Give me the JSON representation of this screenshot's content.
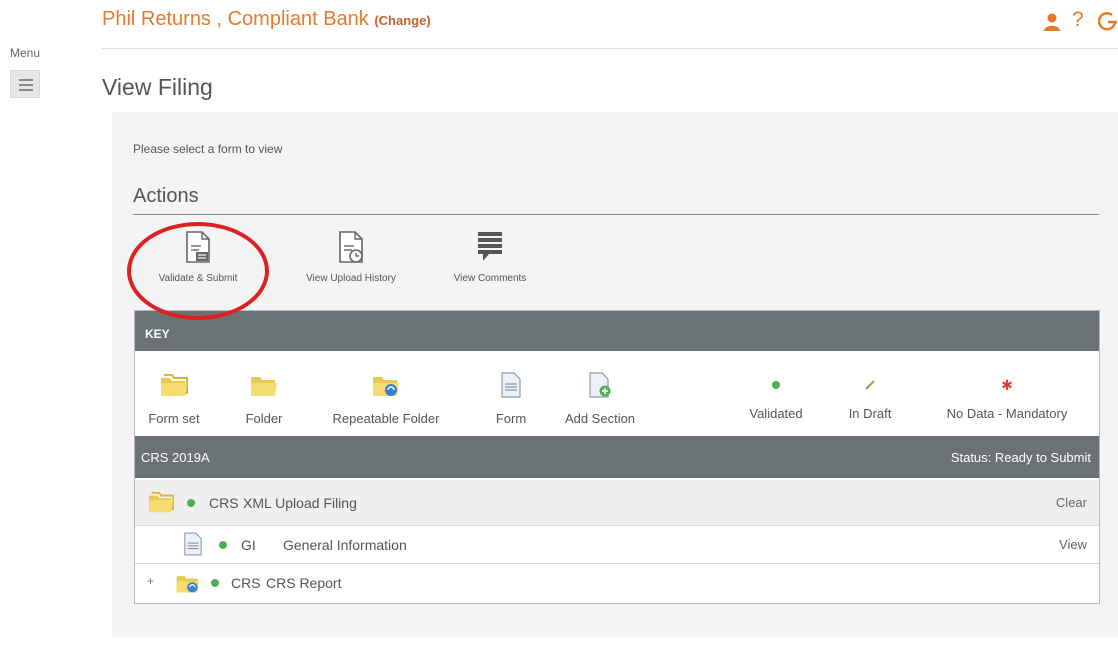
{
  "menu": {
    "label": "Menu"
  },
  "header": {
    "title": "Phil Returns , Compliant Bank ",
    "change_label": "(Change)",
    "icons": [
      "user-icon",
      "help-icon",
      "logout-icon"
    ],
    "accent_color": "#e8792b"
  },
  "page_title": "View Filing",
  "instruction": "Please select a form to view",
  "actions": {
    "heading": "Actions",
    "items": [
      {
        "label": "Validate & Submit",
        "icon": "validate-document-icon"
      },
      {
        "label": "View Upload History",
        "icon": "upload-history-document-icon"
      },
      {
        "label": "View Comments",
        "icon": "comments-icon"
      }
    ]
  },
  "key": {
    "header": "KEY",
    "items": [
      {
        "label": "Form set",
        "icon": "form-set-folder-icon"
      },
      {
        "label": "Folder",
        "icon": "folder-icon"
      },
      {
        "label": "Repeatable Folder",
        "icon": "repeatable-folder-icon"
      },
      {
        "label": "Form",
        "icon": "form-icon"
      },
      {
        "label": "Add Section",
        "icon": "add-section-icon"
      },
      {
        "label": "Validated",
        "icon": "green-dot-icon",
        "color": "#4caf50"
      },
      {
        "label": "In Draft",
        "icon": "pencil-icon",
        "color": "#7cb342"
      },
      {
        "label": "No Data - Mandatory",
        "icon": "red-star-icon",
        "color": "#e53935"
      }
    ]
  },
  "filing": {
    "title": "CRS 2019A",
    "status": "Status: Ready to Submit",
    "rows": [
      {
        "code": "CRS",
        "name": "XML Upload Filing",
        "action": "Clear"
      },
      {
        "code": "GI",
        "name": "General Information",
        "action": "View"
      },
      {
        "code": "CRS",
        "name": "CRS Report",
        "expander": "+"
      }
    ]
  }
}
